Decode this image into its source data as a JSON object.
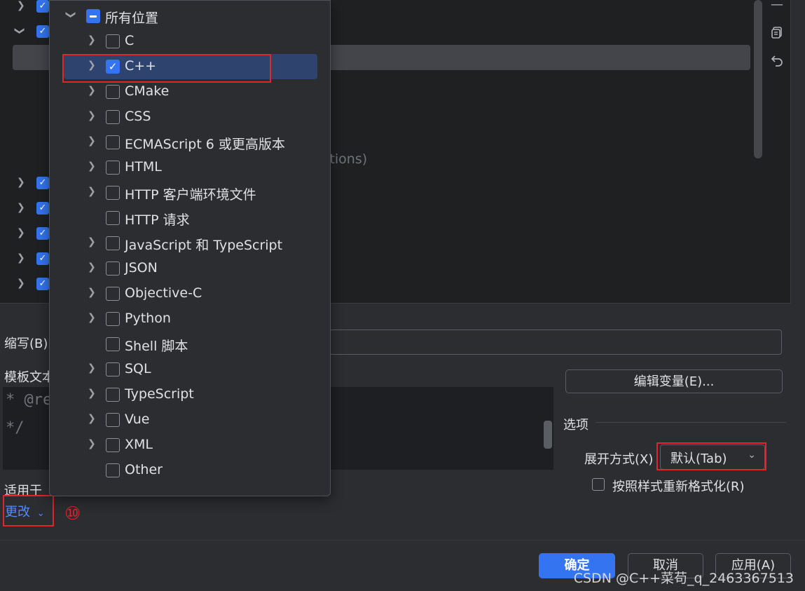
{
  "popup": {
    "root": {
      "label": "所有位置",
      "state": "mixed"
    },
    "items": [
      {
        "label": "C",
        "checked": false,
        "expandable": true
      },
      {
        "label": "C++",
        "checked": true,
        "expandable": true,
        "selected": true
      },
      {
        "label": "CMake",
        "checked": false,
        "expandable": true
      },
      {
        "label": "CSS",
        "checked": false,
        "expandable": true
      },
      {
        "label": "ECMAScript 6 或更高版本",
        "checked": false,
        "expandable": true
      },
      {
        "label": "HTML",
        "checked": false,
        "expandable": true
      },
      {
        "label": "HTTP 客户端环境文件",
        "checked": false,
        "expandable": true
      },
      {
        "label": "HTTP 请求",
        "checked": false,
        "expandable": false
      },
      {
        "label": "JavaScript 和 TypeScript",
        "checked": false,
        "expandable": true
      },
      {
        "label": "JSON",
        "checked": false,
        "expandable": true
      },
      {
        "label": "Objective-C",
        "checked": false,
        "expandable": true
      },
      {
        "label": "Python",
        "checked": false,
        "expandable": true
      },
      {
        "label": "Shell 脚本",
        "checked": false,
        "expandable": false
      },
      {
        "label": "SQL",
        "checked": false,
        "expandable": true
      },
      {
        "label": "TypeScript",
        "checked": false,
        "expandable": true
      },
      {
        "label": "Vue",
        "checked": false,
        "expandable": true
      },
      {
        "label": "XML",
        "checked": false,
        "expandable": true
      },
      {
        "label": "Other",
        "checked": false,
        "expandable": false
      }
    ]
  },
  "background": {
    "partial_text": "ctions)"
  },
  "form": {
    "abbr_label": "缩写(B)",
    "template_label": "模板文本",
    "template_lines": [
      "* @re",
      "*/"
    ],
    "applies_label": "适用于",
    "change_link": "更改",
    "edit_vars_button": "编辑变量(E)...",
    "options_title": "选项",
    "expand_label": "展开方式(X)",
    "expand_value": "默认(Tab)",
    "reformat_label": "按照样式重新格式化(R)",
    "reformat_checked": false,
    "annotation": "⑩"
  },
  "footer": {
    "ok": "确定",
    "cancel": "取消",
    "apply": "应用(A)"
  },
  "watermark": "CSDN @C++菜苟_q_2463367513",
  "colors": {
    "accent": "#3574f0",
    "highlight_box": "#e0252b",
    "selection": "#2e436e"
  }
}
